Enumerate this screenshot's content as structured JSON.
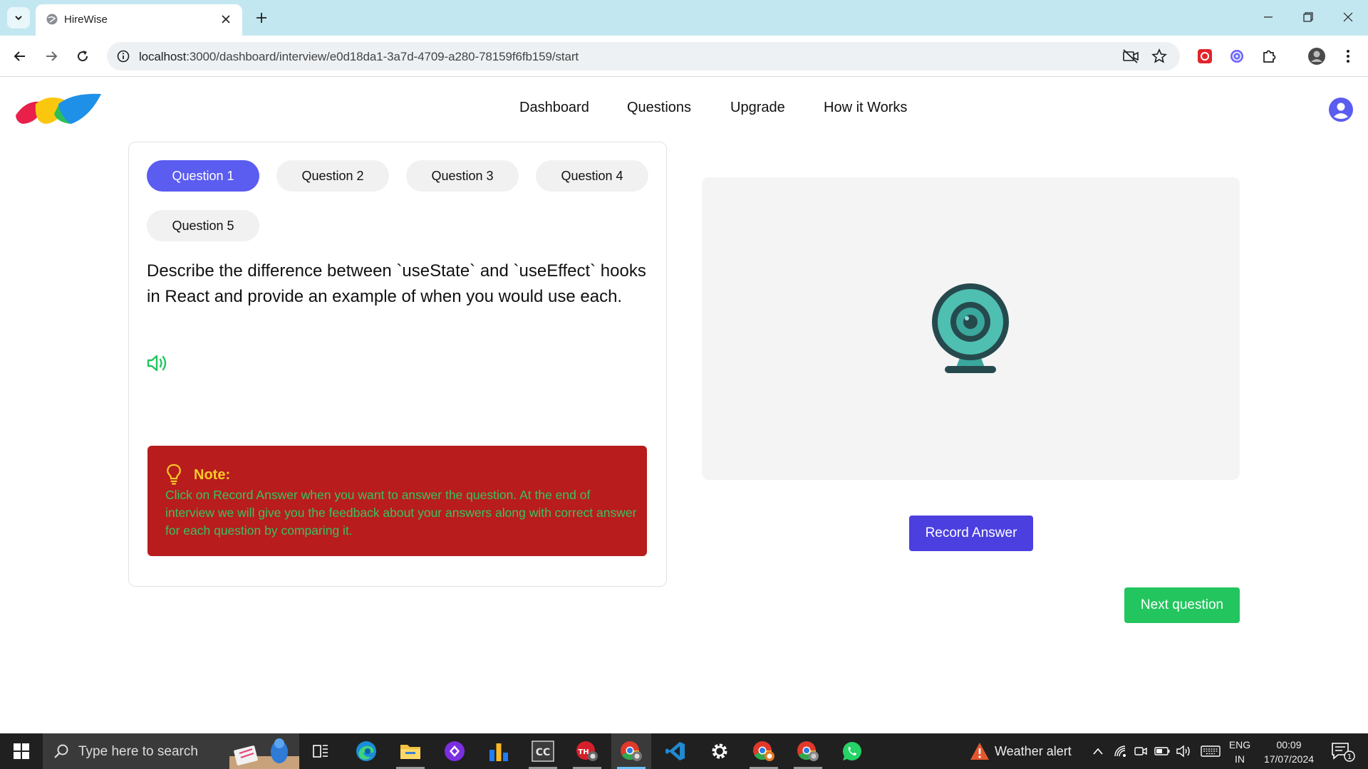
{
  "browser": {
    "tab_title": "HireWise",
    "url_host": "localhost",
    "url_rest": ":3000/dashboard/interview/e0d18da1-3a7d-4709-a280-78159f6fb159/start"
  },
  "header": {
    "nav": [
      "Dashboard",
      "Questions",
      "Upgrade",
      "How it Works"
    ]
  },
  "interview": {
    "questions": [
      "Question 1",
      "Question 2",
      "Question 3",
      "Question 4",
      "Question 5"
    ],
    "active_index": 0,
    "question_text": "Describe the difference between `useState` and `useEffect` hooks in React and provide an example of when you would use each.",
    "note_title": "Note:",
    "note_body": "Click on Record Answer when you want to answer the question. At the end of interview we will give you the feedback about your answers along with correct answer for each question by comparing it.",
    "record_label": "Record Answer",
    "next_label": "Next question"
  },
  "taskbar": {
    "search_placeholder": "Type here to search",
    "weather": "Weather alert",
    "lang_top": "ENG",
    "lang_bottom": "IN",
    "time": "00:09",
    "date": "17/07/2024",
    "notif_count": "1"
  },
  "colors": {
    "primary": "#5b5cf0",
    "record": "#4b3fe0",
    "next": "#22c55e",
    "note_bg": "#b81c1c",
    "note_title": "#f7c928",
    "note_text": "#37c264"
  }
}
